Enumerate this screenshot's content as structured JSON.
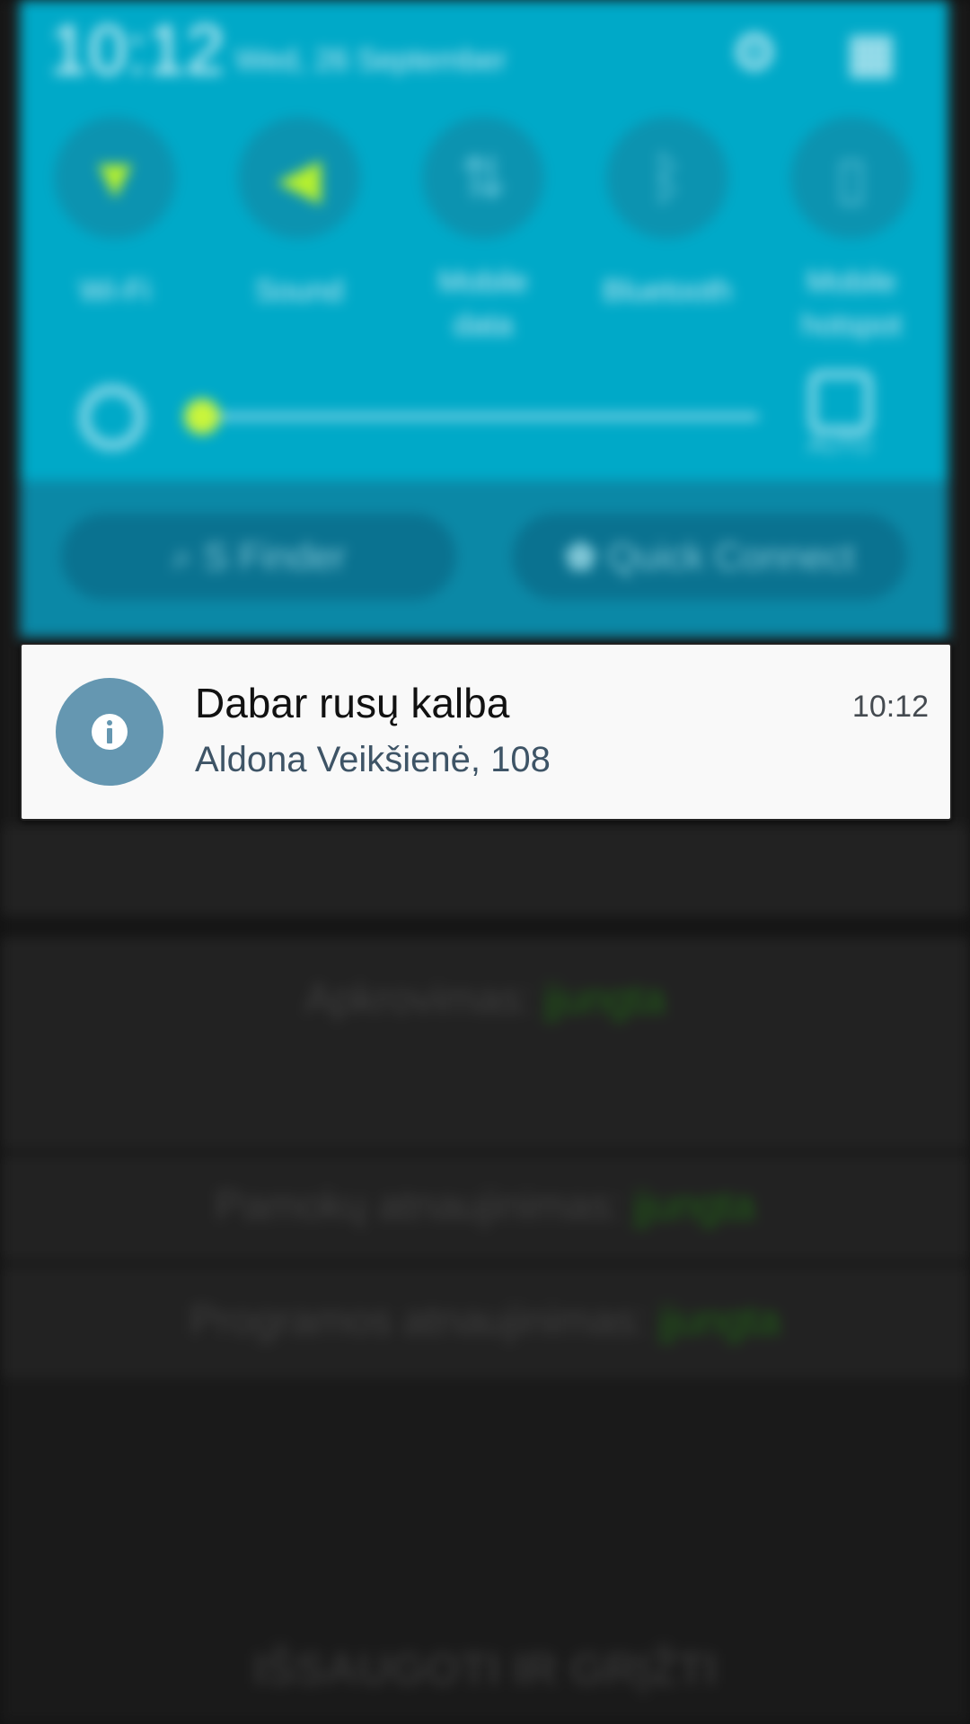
{
  "quick_panel": {
    "time": "10:12",
    "date": "Wed, 26 September",
    "settings_icon": "gear-icon",
    "grid_icon": "grid-icon",
    "toggles": [
      {
        "label": "Wi-Fi",
        "icon": "wifi-icon",
        "state": "on"
      },
      {
        "label": "Sound",
        "icon": "sound-icon",
        "state": "on"
      },
      {
        "label": "Mobile\ndata",
        "icon": "mobile-data-icon",
        "state": "off"
      },
      {
        "label": "Bluetooth",
        "icon": "bluetooth-icon",
        "state": "off"
      },
      {
        "label": "Mobile\nhotspot",
        "icon": "hotspot-icon",
        "state": "off"
      }
    ],
    "brightness": {
      "level": 0.02,
      "auto_label": "AUTO"
    },
    "s_finder": "S Finder",
    "quick_connect": "Quick Connect"
  },
  "notification": {
    "icon": "info-icon",
    "title": "Dabar rusų kalba",
    "subtitle": "Aldona Veikšienė, 108",
    "time": "10:12"
  },
  "background": {
    "rows": [
      {
        "label": "Apkrovimas:",
        "value": "įjungta"
      },
      {
        "label": "Pamokų atnaujinimas:",
        "value": "įjungta"
      },
      {
        "label": "Programos atnaujinimas:",
        "value": "įjungta"
      }
    ],
    "footer_button": "IŠSAUGOTI IR GRĮŽTI"
  }
}
